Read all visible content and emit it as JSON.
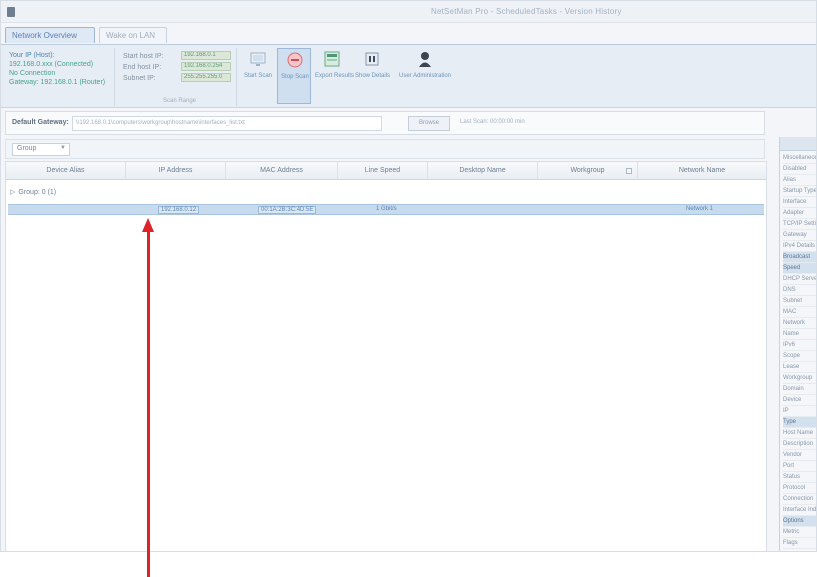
{
  "window": {
    "title": "NetSetMan Pro - ScheduledTasks - Version History"
  },
  "tabs": [
    {
      "label": "Network Overview",
      "active": true
    },
    {
      "label": "Wake on LAN",
      "active": false
    }
  ],
  "ribbon": {
    "info_lines": [
      "Your IP (Host):",
      "192.168.0.xxx (Connected)",
      "No Connection",
      "Gateway: 192.168.0.1 (Router)"
    ],
    "fields_labels": [
      "Start host IP:",
      "End host IP:",
      "Subnet IP:"
    ],
    "fields_values": [
      "192.168.0.1",
      "192.168.0.254",
      "255.255.255.0"
    ],
    "group_caption": "Scan Range",
    "buttons": [
      {
        "label": "Start Scan",
        "icon": "scan-icon"
      },
      {
        "label": "Stop Scan",
        "icon": "stop-icon"
      },
      {
        "label": "Export Results",
        "icon": "export-icon"
      },
      {
        "label": "Show Details",
        "icon": "details-icon"
      },
      {
        "label": "User Administration",
        "icon": "user-icon"
      }
    ]
  },
  "address": {
    "label": "Default Gateway:",
    "value": "\\\\192.168.0.1\\computers\\workgroup\\hostname\\interfaces_list.txt",
    "button": "Browse",
    "info": "Last Scan: 00:00:00 min"
  },
  "groupbar": {
    "label": "Group"
  },
  "columns": [
    "Device Alias",
    "IP Address",
    "MAC Address",
    "Line Speed",
    "Desktop Name",
    "Workgroup",
    "Network Name"
  ],
  "group_row": {
    "label": "Group: 0 (1)"
  },
  "selected_row": {
    "ip": "192.168.0.12",
    "mac": "00:1A:2B:3C:4D:5E",
    "speed": "1 Gbit/s",
    "network": "Network 1"
  },
  "props": {
    "items": [
      "Miscellaneous",
      "Disabled",
      "Alias",
      "Startup Type",
      "Interface",
      "Adapter",
      "TCP/IP Settings",
      "Gateway",
      "IPv4 Details",
      "Broadcast",
      "Speed",
      "DHCP Server",
      "DNS",
      "Subnet",
      "MAC",
      "Network",
      "Name",
      "IPv6",
      "Scope",
      "Lease",
      "Workgroup",
      "Domain",
      "Device",
      "IP",
      "Type",
      "Host Name",
      "Description",
      "Vendor",
      "Port",
      "Status",
      "Protocol",
      "Connection",
      "Interface Index",
      "Options",
      "Metric",
      "Flags"
    ],
    "highlighted": [
      9,
      10,
      24,
      33
    ]
  },
  "colors": {
    "accent": "#5a85b4",
    "selection": "#c7dbef",
    "annotation": "#e0212a"
  }
}
